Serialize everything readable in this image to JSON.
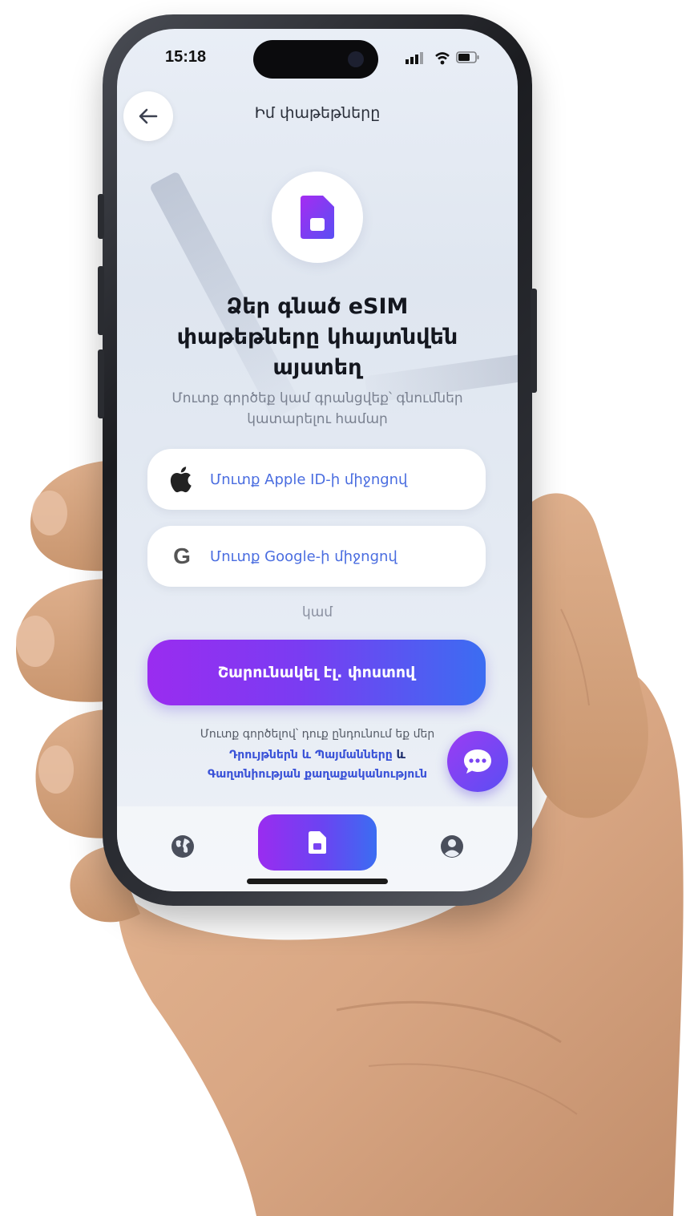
{
  "status_bar": {
    "time": "15:18"
  },
  "header": {
    "title": "Իմ փաթեթները",
    "back_icon": "arrow-left-icon"
  },
  "hero": {
    "icon": "sim-card-icon",
    "headline_line1": "Ձեր գնած eSIM",
    "headline_line2": "փաթեթները կհայտնվեն",
    "headline_line3": "այստեղ",
    "subline_line1": "Մուտք գործեք կամ գրանցվեք՝ գնումներ",
    "subline_line2": "կատարելու համար"
  },
  "auth": {
    "apple_label": "Մուտք Apple ID-ի միջոցով",
    "apple_icon": "apple-icon",
    "google_label": "Մուտք Google-ի միջոցով",
    "google_icon_glyph": "G",
    "or_text": "կամ",
    "guest_label": "Շարունակել էլ. փոստով"
  },
  "terms": {
    "prefix": "Մուտք գործելով՝ դուք ընդունում եք մեր",
    "link_terms": "Դրույթներն և Պայմանները",
    "and": "և",
    "link_privacy": "Գաղտնիության քաղաքականություն"
  },
  "chat": {
    "icon": "chat-bubble-icon"
  },
  "tab_bar": {
    "items": [
      {
        "icon": "globe-icon",
        "active": false
      },
      {
        "icon": "sim-card-icon",
        "active": true
      },
      {
        "icon": "profile-icon",
        "active": false
      }
    ]
  },
  "colors": {
    "accent_purple": "#9a2cf0",
    "accent_blue": "#3b6df2",
    "link_blue": "#3a52d8",
    "screen_bg": "#e4eaf3",
    "skin": "#d9a784"
  }
}
